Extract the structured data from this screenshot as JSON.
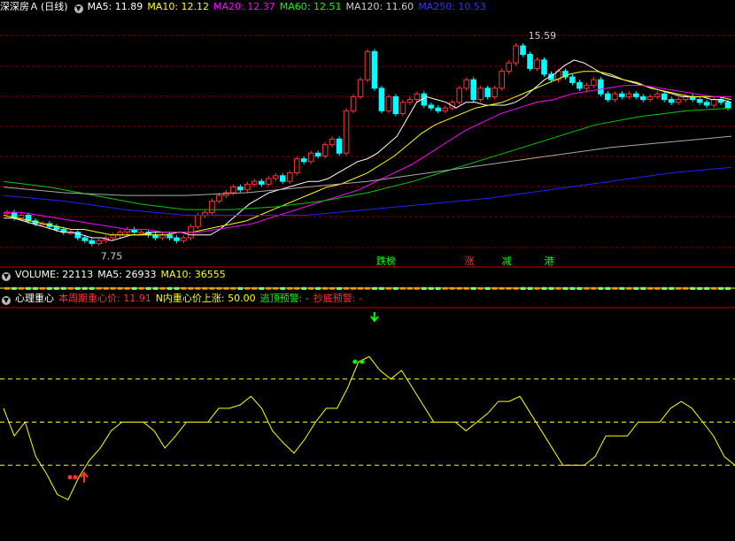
{
  "header": {
    "stock_name": "深深房Ａ",
    "period": "(日线)",
    "ma": [
      {
        "label": "MA5: 11.89",
        "color": "#ffffff"
      },
      {
        "label": "MA10: 12.12",
        "color": "#ffff00"
      },
      {
        "label": "MA20: 12.37",
        "color": "#ff00ff"
      },
      {
        "label": "MA60: 12.51",
        "color": "#00ff00"
      },
      {
        "label": "MA120: 11.60",
        "color": "#cccccc"
      },
      {
        "label": "MA250: 10.53",
        "color": "#3333ff"
      }
    ]
  },
  "price_chart": {
    "high_label": "15.59",
    "low_label": "7.75",
    "signals": [
      {
        "text": "跌榜",
        "color": "#00ff00"
      },
      {
        "text": "涨",
        "color": "#ff3333"
      },
      {
        "text": "减",
        "color": "#00ff00"
      },
      {
        "text": "港",
        "color": "#00ff00"
      }
    ]
  },
  "volume_bar": {
    "volume_label": "VOLUME: 22113",
    "ma5_label": "MA5: 26933",
    "ma10_label": "MA10: 36555"
  },
  "indicator_bar": {
    "name": "心理重心",
    "fields": [
      {
        "label": "本周期重心价: 11.91",
        "color": "#ff3333"
      },
      {
        "label": "N内重心价上涨: 50.00",
        "color": "#ffff00"
      },
      {
        "label": "逃顶预警: -",
        "color": "#00ff00"
      },
      {
        "label": "抄底预警: -",
        "color": "#ff3333"
      }
    ]
  },
  "colors": {
    "up": "#ff3333",
    "down": "#00ffff",
    "indicator": "#ffff00",
    "grid_red": "#ff0000"
  },
  "chart_data": [
    {
      "type": "candlestick",
      "title": "深深房Ａ (日线)",
      "ylim": [
        7.5,
        15.8
      ],
      "count": 103,
      "close": [
        8.9,
        8.7,
        8.8,
        8.6,
        8.5,
        8.5,
        8.4,
        8.3,
        8.2,
        8.2,
        8.0,
        7.9,
        7.8,
        7.9,
        8.0,
        8.1,
        8.2,
        8.3,
        8.2,
        8.2,
        8.1,
        8.0,
        8.1,
        8.0,
        7.9,
        8.0,
        8.4,
        8.8,
        8.9,
        9.3,
        9.5,
        9.6,
        9.8,
        9.7,
        9.9,
        10.0,
        9.9,
        10.1,
        10.2,
        10.0,
        10.3,
        10.8,
        10.7,
        11.0,
        10.9,
        11.3,
        11.5,
        11.0,
        12.5,
        13.0,
        13.6,
        14.6,
        13.3,
        12.5,
        13.0,
        12.4,
        12.8,
        12.9,
        13.1,
        12.7,
        12.6,
        12.5,
        12.6,
        12.8,
        13.3,
        13.6,
        12.9,
        13.3,
        13.0,
        13.3,
        13.9,
        14.2,
        14.8,
        14.5,
        14.0,
        14.3,
        13.8,
        13.6,
        13.9,
        13.7,
        13.5,
        13.3,
        13.4,
        13.6,
        13.1,
        12.9,
        13.1,
        13.0,
        13.1,
        13.0,
        12.9,
        13.0,
        13.1,
        12.9,
        12.8,
        12.9,
        13.0,
        12.9,
        12.8,
        12.7,
        12.9,
        12.8,
        12.6
      ],
      "ma": [
        {
          "name": "MA5",
          "values": [
            8.7,
            8.7,
            8.6,
            8.5,
            8.4,
            8.3,
            8.2,
            8.2,
            8.1,
            8.0,
            8.0,
            7.9,
            8.0,
            8.1,
            8.1,
            8.2,
            8.2,
            8.2,
            8.2,
            8.1,
            8.1,
            8.1,
            8.3,
            8.6,
            8.9,
            9.2,
            9.4,
            9.6,
            9.7,
            9.8,
            9.9,
            10.0,
            10.0,
            10.1,
            10.3,
            10.5,
            10.7,
            10.8,
            11.0,
            11.3,
            11.6,
            12.2,
            12.8,
            13.0,
            12.9,
            12.8,
            12.6,
            12.8,
            12.8,
            12.7,
            12.7,
            12.7,
            12.8,
            13.0,
            13.3,
            13.6,
            13.8,
            14.1,
            14.3,
            14.2,
            14.0,
            13.8,
            13.7,
            13.6,
            13.5,
            13.4,
            13.3,
            13.2,
            13.1,
            13.0,
            13.0,
            13.0,
            12.9,
            12.9,
            12.8
          ]
        },
        {
          "name": "MA10",
          "values": [
            8.8,
            8.7,
            8.6,
            8.5,
            8.4,
            8.3,
            8.3,
            8.2,
            8.1,
            8.1,
            8.1,
            8.1,
            8.1,
            8.2,
            8.2,
            8.3,
            8.4,
            8.5,
            8.6,
            8.8,
            9.0,
            9.2,
            9.4,
            9.6,
            9.8,
            9.9,
            10.1,
            10.3,
            10.6,
            10.9,
            11.3,
            11.7,
            12.0,
            12.2,
            12.4,
            12.6,
            12.7,
            12.8,
            13.0,
            13.2,
            13.4,
            13.6,
            13.8,
            13.9,
            13.9,
            13.8,
            13.6,
            13.5,
            13.3,
            13.2,
            13.1,
            13.0,
            13.0,
            13.0,
            12.9
          ]
        },
        {
          "name": "MA20",
          "values": [
            8.9,
            8.9,
            8.8,
            8.7,
            8.6,
            8.5,
            8.4,
            8.3,
            8.3,
            8.2,
            8.2,
            8.2,
            8.3,
            8.4,
            8.5,
            8.7,
            8.9,
            9.1,
            9.3,
            9.5,
            9.7,
            10.0,
            10.3,
            10.6,
            11.0,
            11.4,
            11.8,
            12.1,
            12.4,
            12.6,
            12.8,
            12.9,
            13.1,
            13.2,
            13.3,
            13.4,
            13.4,
            13.3,
            13.2,
            13.1,
            13.0,
            13.0
          ]
        },
        {
          "name": "MA60",
          "values": [
            10.0,
            9.8,
            9.5,
            9.2,
            9.0,
            9.0,
            9.1,
            9.3,
            9.6,
            10.0,
            10.5,
            11.0,
            11.5,
            12.0,
            12.3,
            12.5,
            12.6
          ]
        },
        {
          "name": "MA120",
          "values": [
            9.8,
            9.6,
            9.5,
            9.5,
            9.6,
            9.8,
            10.0,
            10.3,
            10.6,
            10.9,
            11.2,
            11.4,
            11.6
          ]
        },
        {
          "name": "MA250",
          "values": [
            9.5,
            9.3,
            9.0,
            8.8,
            8.8,
            8.8,
            9.0,
            9.2,
            9.4,
            9.7,
            10.0,
            10.3,
            10.5
          ]
        }
      ]
    },
    {
      "type": "bar",
      "title": "VOLUME",
      "values": [
        1,
        1,
        1,
        1,
        1,
        1,
        1,
        1,
        1,
        1,
        1,
        1,
        1,
        1,
        1,
        1,
        1,
        1,
        1,
        1,
        1,
        1,
        1,
        1,
        1,
        1,
        1,
        1,
        1,
        1,
        1,
        1,
        1,
        1,
        1,
        1,
        1,
        1,
        1,
        1,
        1,
        1,
        1,
        1,
        1,
        1,
        1,
        1,
        1,
        1,
        1,
        1,
        1,
        1,
        1,
        1,
        1,
        1,
        1,
        1,
        1,
        1,
        1,
        1,
        1,
        1,
        1,
        1,
        1,
        1,
        1,
        1,
        1,
        1,
        1,
        1,
        1,
        1,
        1,
        1,
        1,
        1,
        1,
        1,
        1,
        1,
        1,
        1,
        1,
        1,
        1,
        1,
        1,
        1,
        1,
        1,
        1,
        1,
        1,
        1,
        1,
        1,
        1
      ],
      "ylim": [
        0,
        10
      ]
    },
    {
      "type": "line",
      "title": "心理重心",
      "ylim": [
        0,
        100
      ],
      "levels": [
        25,
        50,
        75
      ],
      "series": [
        {
          "values": [
            58,
            42,
            50,
            30,
            20,
            8,
            5,
            18,
            28,
            35,
            45,
            50,
            50,
            50,
            45,
            35,
            42,
            50,
            50,
            50,
            58,
            58,
            60,
            65,
            58,
            45,
            38,
            32,
            40,
            50,
            58,
            58,
            70,
            85,
            88,
            80,
            75,
            80,
            70,
            60,
            50,
            50,
            50,
            45,
            50,
            55,
            62,
            62,
            65,
            55,
            45,
            35,
            25,
            25,
            25,
            30,
            42,
            42,
            42,
            50,
            50,
            50,
            58,
            62,
            58,
            50,
            42,
            30,
            25
          ]
        }
      ],
      "markers": [
        {
          "type": "buy",
          "index": 7
        },
        {
          "type": "sell",
          "index": 33
        }
      ]
    }
  ]
}
